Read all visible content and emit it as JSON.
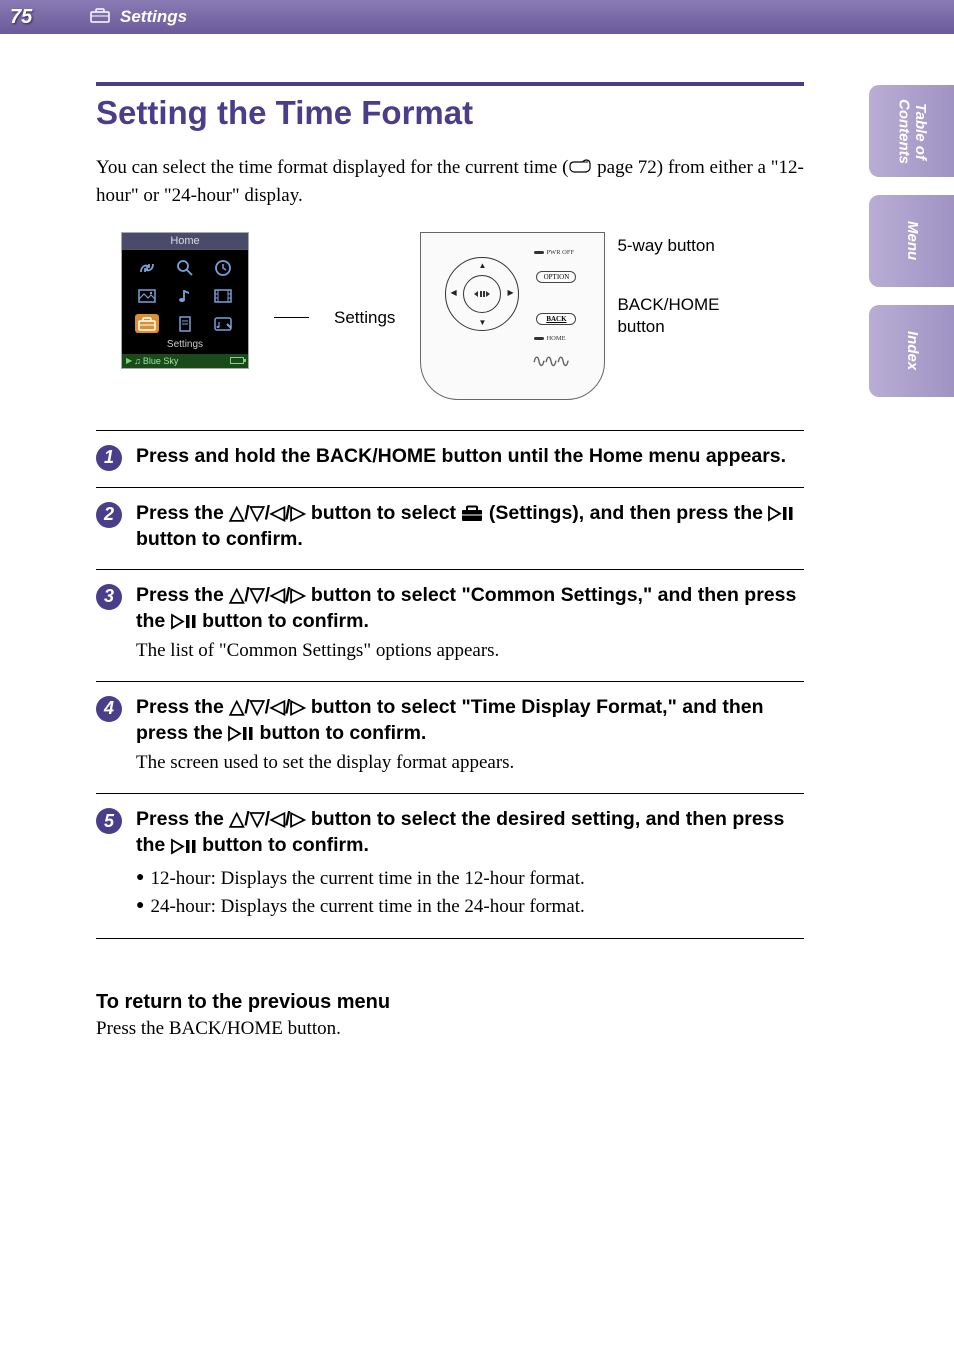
{
  "header": {
    "page_number": "75",
    "section": "Settings"
  },
  "side_tabs": {
    "toc_line1": "Table of",
    "toc_line2": "Contents",
    "menu": "Menu",
    "index": "Index"
  },
  "main": {
    "title": "Setting the Time Format",
    "intro_part1": "You can select the time format displayed for the current time (",
    "intro_page_ref": " page 72) from either a \"12-hour\" or \"24-hour\" display.",
    "diagram": {
      "screen_title": "Home",
      "screen_label": "Settings",
      "screen_nowplaying": "Blue Sky",
      "callout_settings": "Settings",
      "callout_5way": "5-way button",
      "callout_backhome_l1": "BACK/HOME",
      "callout_backhome_l2": "button",
      "device_labels": {
        "pwr": "PWR OFF",
        "option": "OPTION",
        "back": "BACK",
        "home": "HOME"
      }
    }
  },
  "steps": [
    {
      "num": "1",
      "title": "Press and hold the BACK/HOME button until the Home menu appears."
    },
    {
      "num": "2",
      "title_a": "Press the ",
      "title_b": " button to select ",
      "title_c": " (Settings), and then press the ",
      "title_d": " button to confirm."
    },
    {
      "num": "3",
      "title_a": "Press the ",
      "title_b": " button to select \"Common Settings,\" and then press the ",
      "title_c": " button to confirm.",
      "desc": "The list of \"Common Settings\" options appears."
    },
    {
      "num": "4",
      "title_a": "Press the ",
      "title_b": " button to select \"Time Display Format,\" and then press the ",
      "title_c": " button to confirm.",
      "desc": "The screen used to set the display format appears."
    },
    {
      "num": "5",
      "title_a": "Press the ",
      "title_b": " button to select the desired setting, and then press the ",
      "title_c": " button to confirm.",
      "bullets": [
        "12-hour: Displays the current time in the 12-hour format.",
        "24-hour: Displays the current time in the 24-hour format."
      ]
    }
  ],
  "return": {
    "title": "To return to the previous menu",
    "text": "Press the BACK/HOME button."
  },
  "glyphs": {
    "arrows": "△/▽/◁/▷"
  }
}
